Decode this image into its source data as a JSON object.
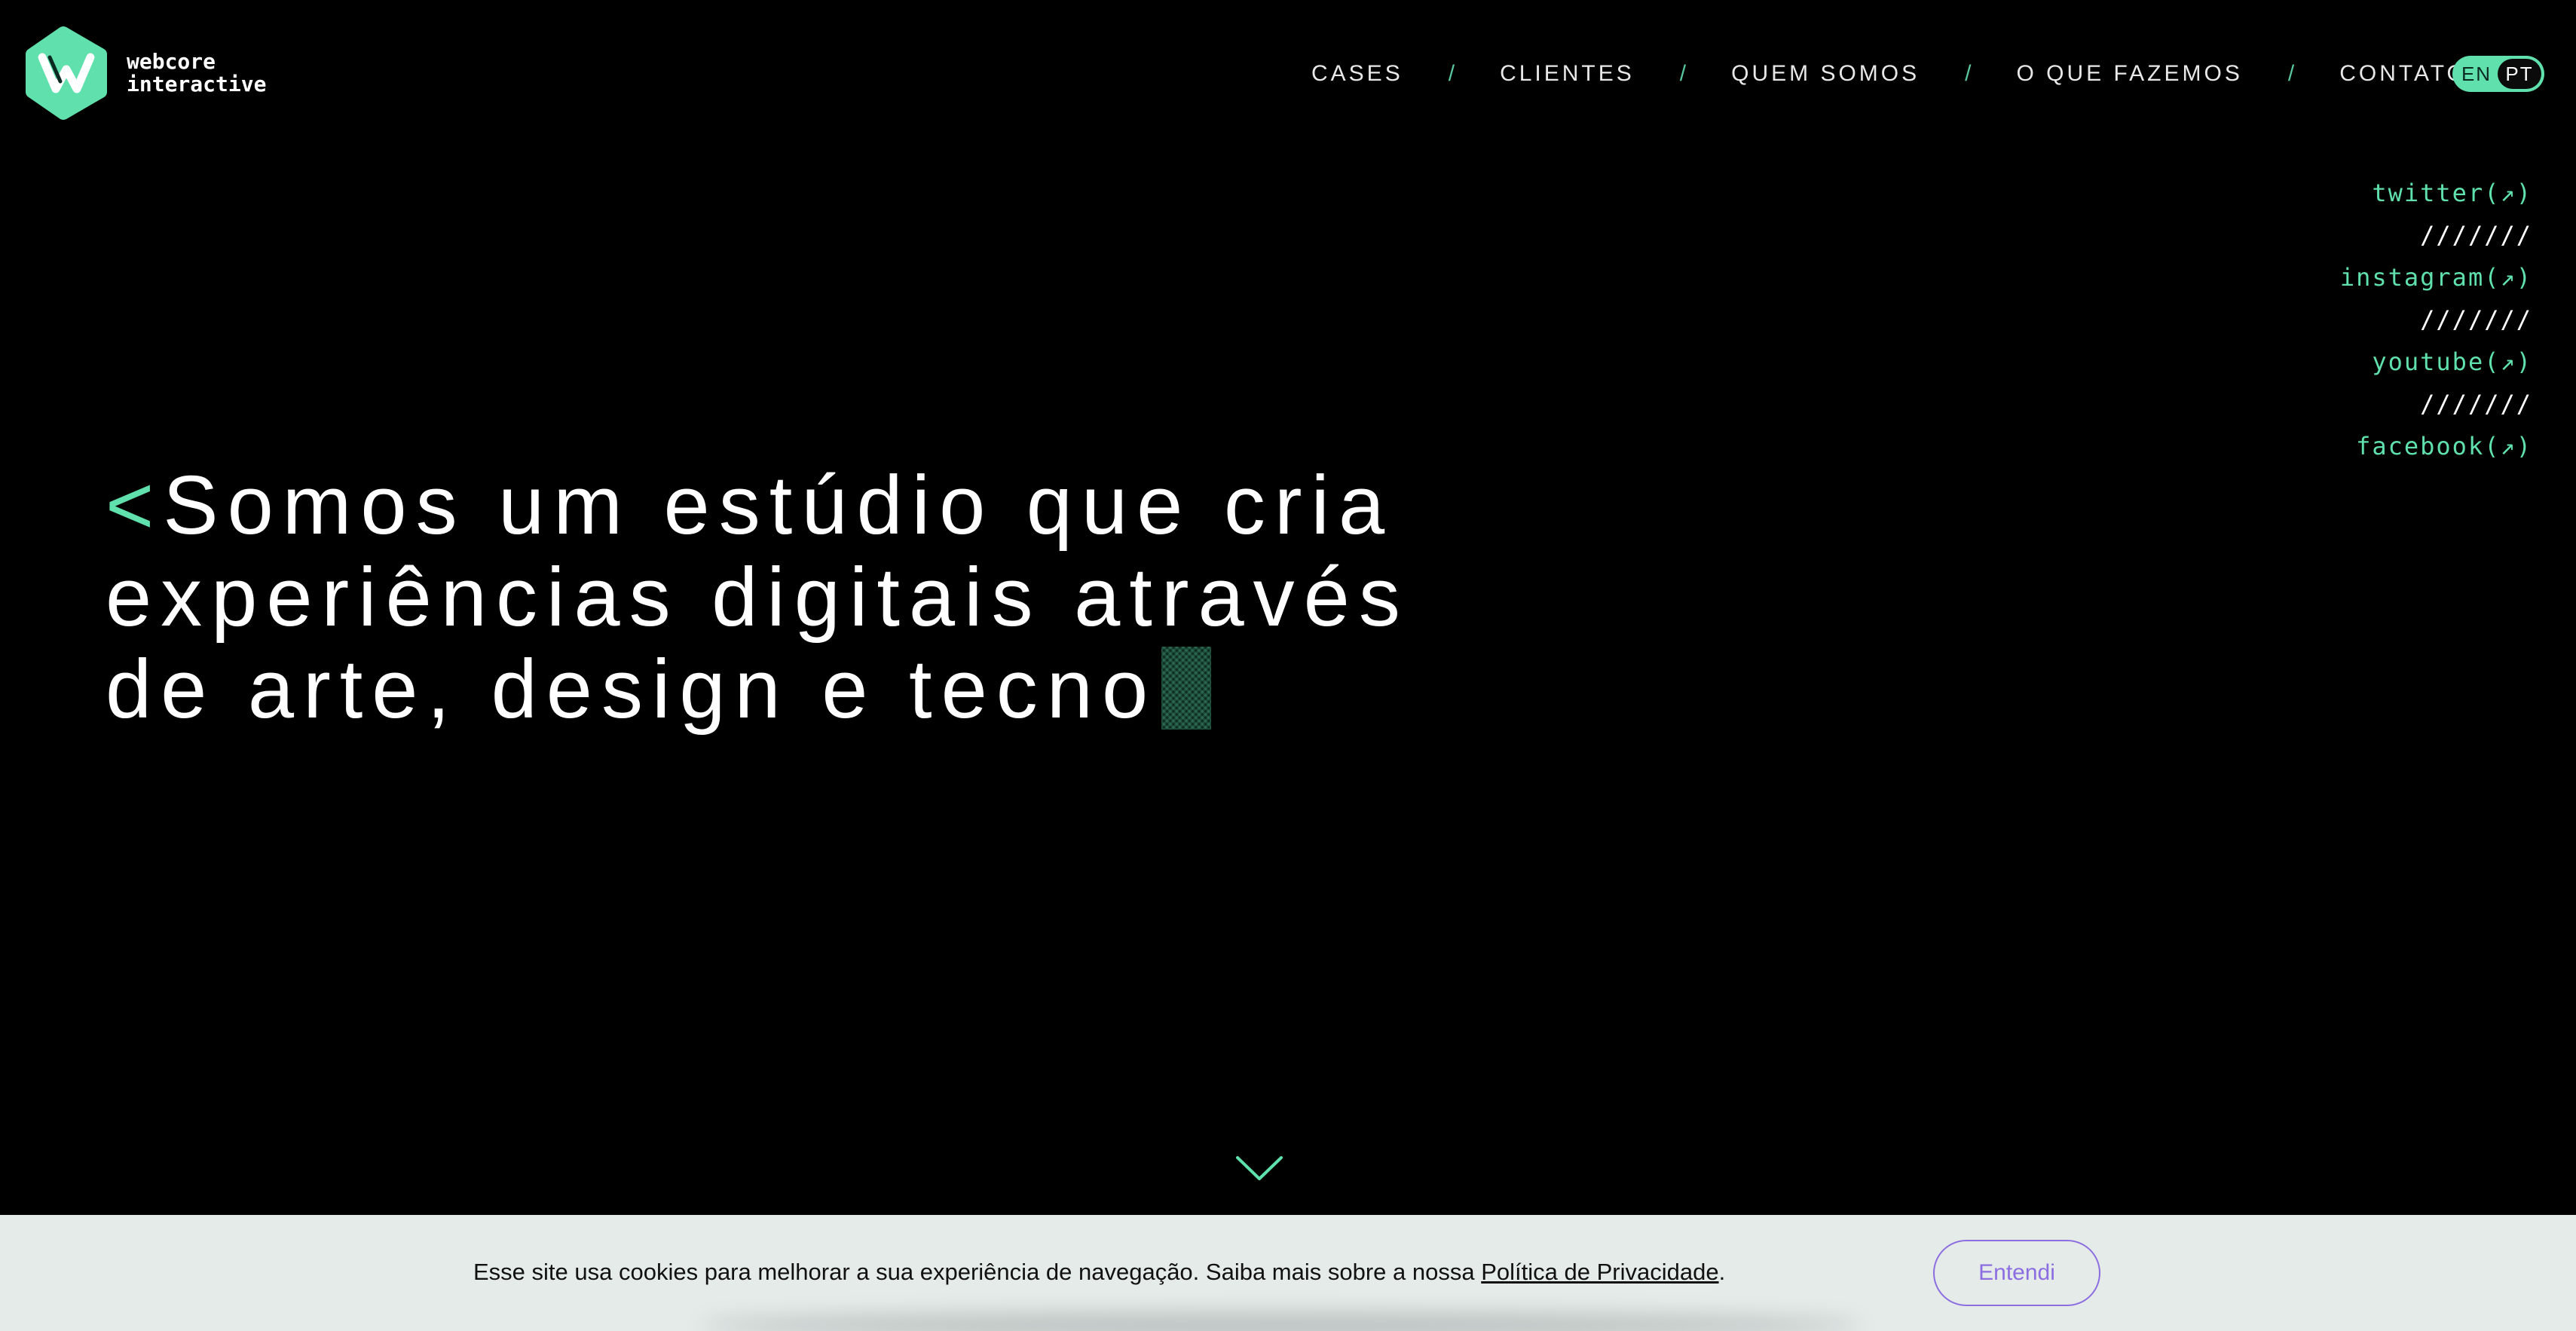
{
  "brand": {
    "name_line1": "webcore",
    "name_line2": "interactive",
    "accent_color": "#5fe0ad",
    "logo_icon": "webcore-hexagon-logo"
  },
  "nav": {
    "items": [
      {
        "label": "CASES"
      },
      {
        "label": "CLIENTES"
      },
      {
        "label": "QUEM SOMOS"
      },
      {
        "label": "O QUE FAZEMOS"
      },
      {
        "label": "CONTATO"
      }
    ],
    "separator": "/"
  },
  "language": {
    "options": [
      "EN",
      "PT"
    ],
    "selected": "PT"
  },
  "social": {
    "links": [
      {
        "label": "twitter(↗)"
      },
      {
        "label": "instagram(↗)"
      },
      {
        "label": "youtube(↗)"
      },
      {
        "label": "facebook(↗)"
      }
    ],
    "separator": "///////"
  },
  "hero": {
    "bracket": "<",
    "line1": "Somos um estúdio que cria",
    "line2": "experiências digitais através",
    "line3": "de arte, design e tecno"
  },
  "scroll": {
    "icon": "chevron-down-icon"
  },
  "cookie": {
    "text": "Esse site usa cookies para melhorar a sua experiência de navegação. Saiba mais sobre a nossa ",
    "link_label": "Política de Privacidade",
    "suffix": ".",
    "button_label": "Entendi",
    "button_color": "#8d6ee0",
    "background_color": "#e4ebe9"
  }
}
